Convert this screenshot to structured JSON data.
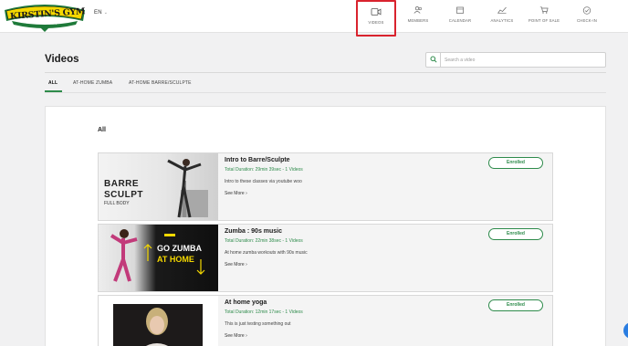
{
  "header": {
    "logo_text": "KIRSTIN'S GYM",
    "logo_tagline": "Fitness for Everybody",
    "language": "EN",
    "nav": [
      {
        "label": "VIDEOS",
        "icon": "video-icon",
        "active": true
      },
      {
        "label": "MEMBERS",
        "icon": "members-icon"
      },
      {
        "label": "CALENDAR",
        "icon": "calendar-icon"
      },
      {
        "label": "ANALYTICS",
        "icon": "analytics-icon"
      },
      {
        "label": "POINT OF SALE",
        "icon": "cart-icon"
      },
      {
        "label": "CHECK-IN",
        "icon": "check-circle-icon"
      }
    ]
  },
  "page": {
    "title": "Videos",
    "search_placeholder": "Search a video"
  },
  "tabs": [
    {
      "label": "ALL",
      "active": true
    },
    {
      "label": "AT-HOME ZUMBA"
    },
    {
      "label": "AT-HOME BARRE/SCULPTE"
    }
  ],
  "section": {
    "title": "All"
  },
  "videos": [
    {
      "title": "Intro to Barre/Sculpte",
      "duration": "Total Duration: 29min 39sec - 1 Videos",
      "description": "Intro to these classes via youtube woo",
      "see_more": "See More ›",
      "status": "Enrolled",
      "thumb_text": [
        "BARRE",
        "SCULPT",
        "FULL BODY"
      ]
    },
    {
      "title": "Zumba : 90s music",
      "duration": "Total Duration: 22min 38sec - 1 Videos",
      "description": "At home zumba workouts with 90s music",
      "see_more": "See More ›",
      "status": "Enrolled",
      "thumb_text": [
        "GO ZUMBA",
        "AT HOME"
      ]
    },
    {
      "title": "At home yoga",
      "duration": "Total Duration: 12min 17sec - 1 Videos",
      "description": "This is just testing something out",
      "see_more": "See More ›",
      "status": "Enrolled"
    }
  ],
  "colors": {
    "accent_green": "#2e8b4b",
    "highlight_red": "#d9232e",
    "logo_yellow": "#f5d800",
    "chat_blue": "#2a7de1"
  }
}
